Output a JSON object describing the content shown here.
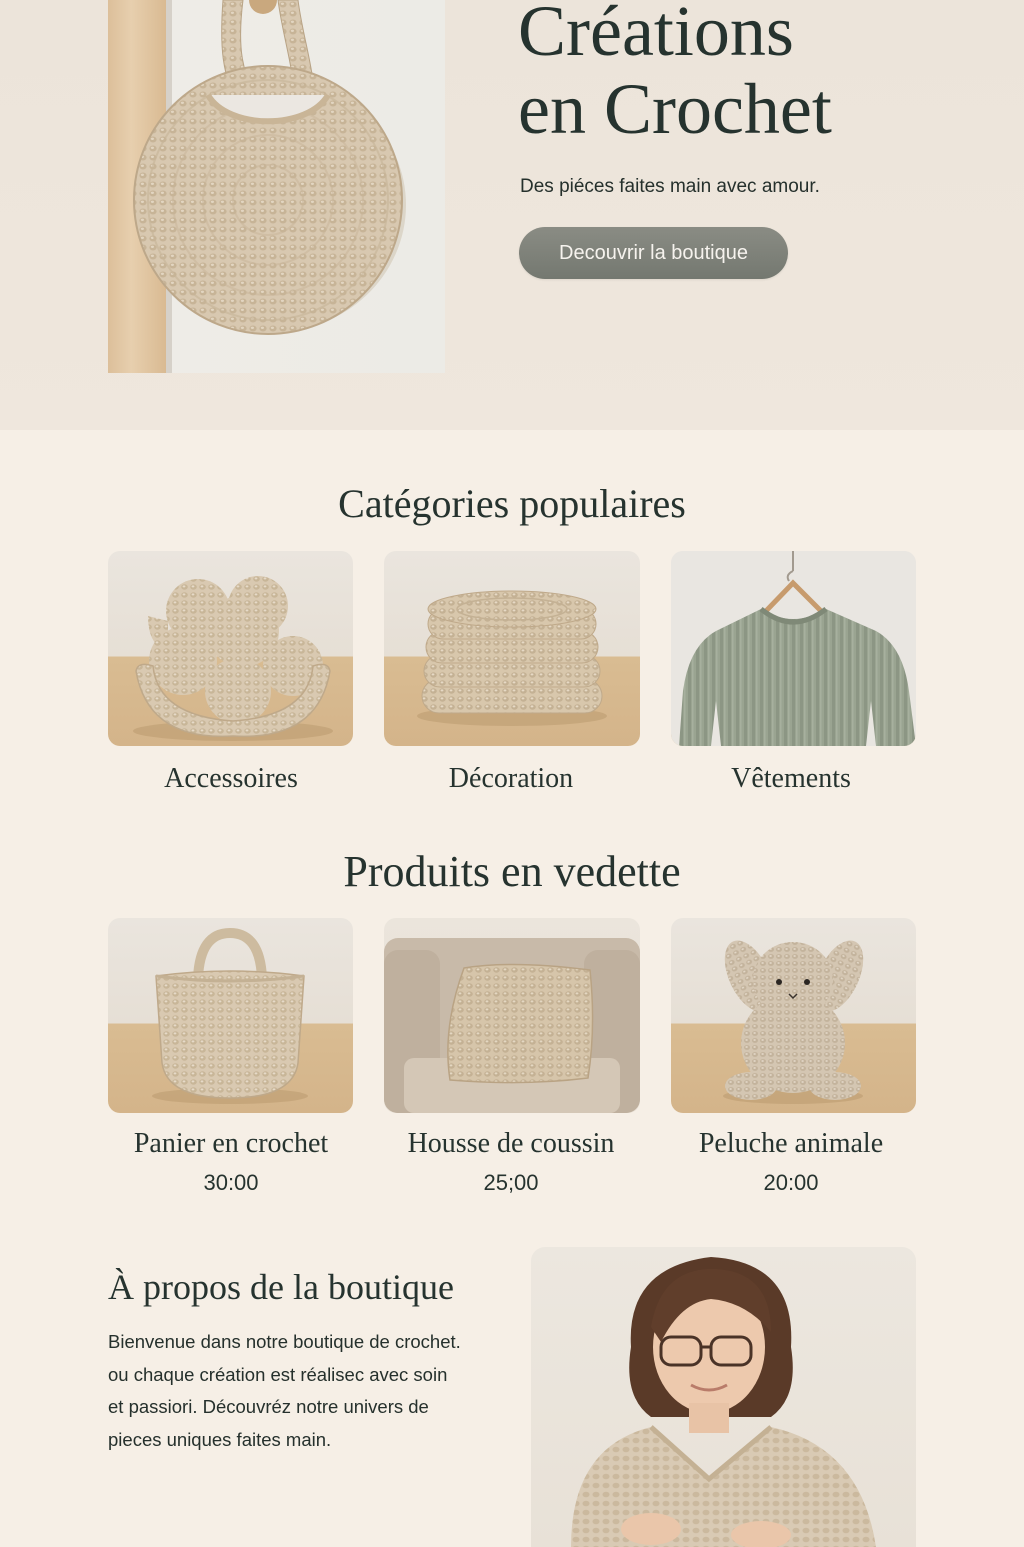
{
  "hero": {
    "title_line1": "Créations",
    "title_line2": "en Crochet",
    "subtitle": "Des piéces faites main avec amour.",
    "cta_label": "Decouvrir la boutique"
  },
  "categories": {
    "title": "Catégories populaires",
    "items": [
      {
        "label": "Accessoires"
      },
      {
        "label": "Décoration"
      },
      {
        "label": "Vêtements"
      }
    ]
  },
  "featured": {
    "title": "Produits en vedette",
    "items": [
      {
        "name": "Panier en crochet",
        "price": "30:00"
      },
      {
        "name": "Housse de coussin",
        "price": "25;00"
      },
      {
        "name": "Peluche animale",
        "price": "20:00"
      }
    ]
  },
  "about": {
    "title": "À propos de la boutique",
    "lines": [
      "Bienvenue dans notre boutique de crochet.",
      "ou chaque création est réalisec avec soin",
      "et passiori. Découvréz notre univers de",
      "pieces uniques faites main."
    ]
  },
  "colors": {
    "page_background": "#f6efe6",
    "hero_background": "#ece4da",
    "heading_text": "#26332f",
    "button": "#7f827a",
    "yarn_beige": "#d8c8b0",
    "sweater_green": "#9aa491"
  }
}
